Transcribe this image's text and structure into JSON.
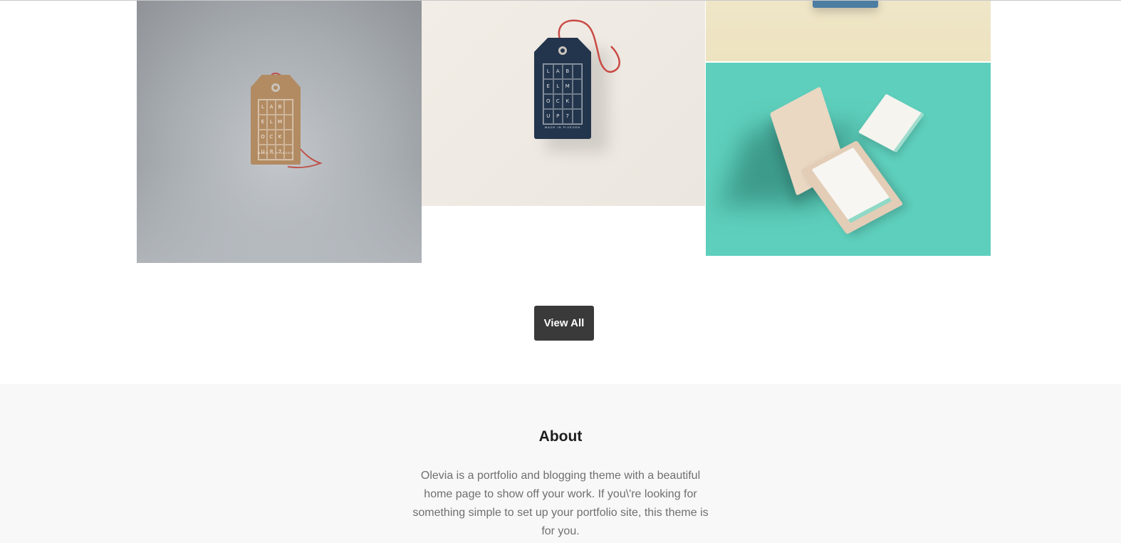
{
  "gallery": {
    "tiles": [
      {
        "label": "kraft-label-tag-mockup",
        "tag_letters": [
          "L",
          "A",
          "B",
          "",
          "E",
          "L",
          "M",
          "",
          "O",
          "C",
          "K",
          "",
          "U",
          "P",
          "7",
          ""
        ],
        "tag_footer": "MADE IN PIXEDEN"
      },
      {
        "label": "navy-label-tag-mockup",
        "tag_letters": [
          "L",
          "A",
          "B",
          "",
          "E",
          "L",
          "M",
          "",
          "O",
          "C",
          "K",
          "",
          "U",
          "P",
          "7",
          ""
        ],
        "tag_footer": "MADE IN PIXEDEN"
      },
      {
        "label": "yellow-background-card"
      },
      {
        "label": "business-card-box-mockup"
      }
    ]
  },
  "actions": {
    "view_all_label": "View All"
  },
  "about": {
    "title": "About",
    "text": "Olevia is a portfolio and blogging theme with a beautiful home page to show off your work. If you\\'re looking for something simple to set up your portfolio site, this theme is for you."
  },
  "colors": {
    "button_bg": "#3a3a3a",
    "teal_tile": "#5ecfbc",
    "navy_tag": "#23354c",
    "kraft_tag": "#b28b62",
    "about_bg": "#f8f8f8"
  }
}
